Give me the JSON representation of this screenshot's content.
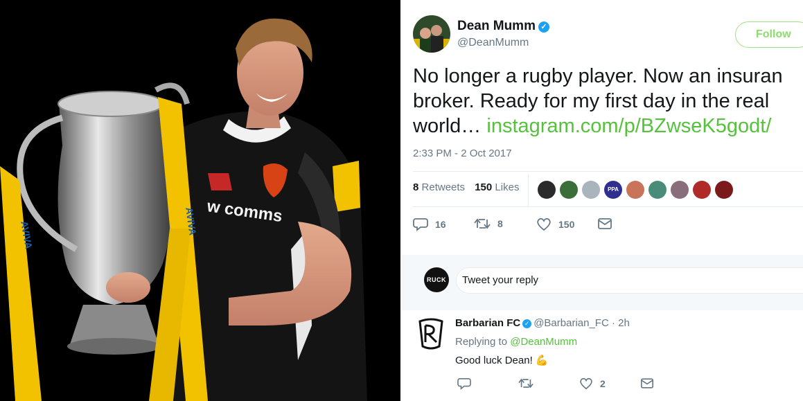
{
  "photo": {
    "shirt_text": "w comms",
    "ribbon_text": "AVIVA"
  },
  "tweet": {
    "author": {
      "name": "Dean Mumm",
      "handle": "@DeanMumm",
      "verified": true
    },
    "follow_label": "Follow",
    "text_lines": [
      "No longer a rugby player. Now an insuran",
      "broker. Ready for my first day in the real"
    ],
    "text_line3": "world…",
    "link": "instagram.com/p/BZwseK5godt/",
    "timestamp": "2:33 PM - 2 Oct 2017",
    "stats": {
      "retweets_count": "8",
      "retweets_label": "Retweets",
      "likes_count": "150",
      "likes_label": "Likes"
    },
    "likers": [
      {
        "name": "liker-1",
        "color": "#2b2b2b"
      },
      {
        "name": "liker-2",
        "color": "#3c6e3a"
      },
      {
        "name": "liker-3",
        "color": "#aab4bd"
      },
      {
        "name": "liker-4",
        "color": "#2f2f8f",
        "text": "PPA"
      },
      {
        "name": "liker-5",
        "color": "#c9745a"
      },
      {
        "name": "liker-6",
        "color": "#4a8c7a"
      },
      {
        "name": "liker-7",
        "color": "#8a6d7a"
      },
      {
        "name": "liker-8",
        "color": "#b02a2a"
      },
      {
        "name": "liker-9",
        "color": "#7a1a1a"
      }
    ],
    "actions": {
      "reply_count": "16",
      "retweet_count": "8",
      "like_count": "150"
    }
  },
  "reply_box": {
    "avatar_text": "RUCK",
    "placeholder": "Tweet your reply"
  },
  "reply": {
    "name": "Barbarian FC",
    "handle": "@Barbarian_FC",
    "time": "· 2h",
    "replying_label": "Replying to",
    "replying_handle": "@DeanMumm",
    "text": "Good luck Dean!",
    "emoji": "💪",
    "like_count": "2"
  },
  "colors": {
    "accent_green": "#55c23b",
    "verified_blue": "#1da1f2",
    "muted": "#657786"
  }
}
